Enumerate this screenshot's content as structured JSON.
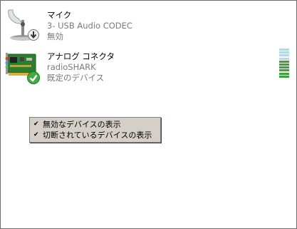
{
  "devices": [
    {
      "name": "マイク",
      "detail": "3- USB Audio CODEC",
      "status": "無効",
      "icon": "microphone-icon",
      "overlay_icon": "disabled-arrow-icon"
    },
    {
      "name": "アナログ コネクタ",
      "detail": "radioSHARK",
      "status": "既定のデバイス",
      "icon": "sound-card-icon",
      "overlay_icon": "default-check-icon"
    }
  ],
  "level_meter": {
    "level": 0.55,
    "colors": {
      "active": "#3aa53a",
      "inactive": "#b9d8e6"
    }
  },
  "context_menu": {
    "items": [
      {
        "label": "無効なデバイスの表示",
        "checked": true
      },
      {
        "label": "切断されているデバイスの表示",
        "checked": true
      }
    ]
  }
}
